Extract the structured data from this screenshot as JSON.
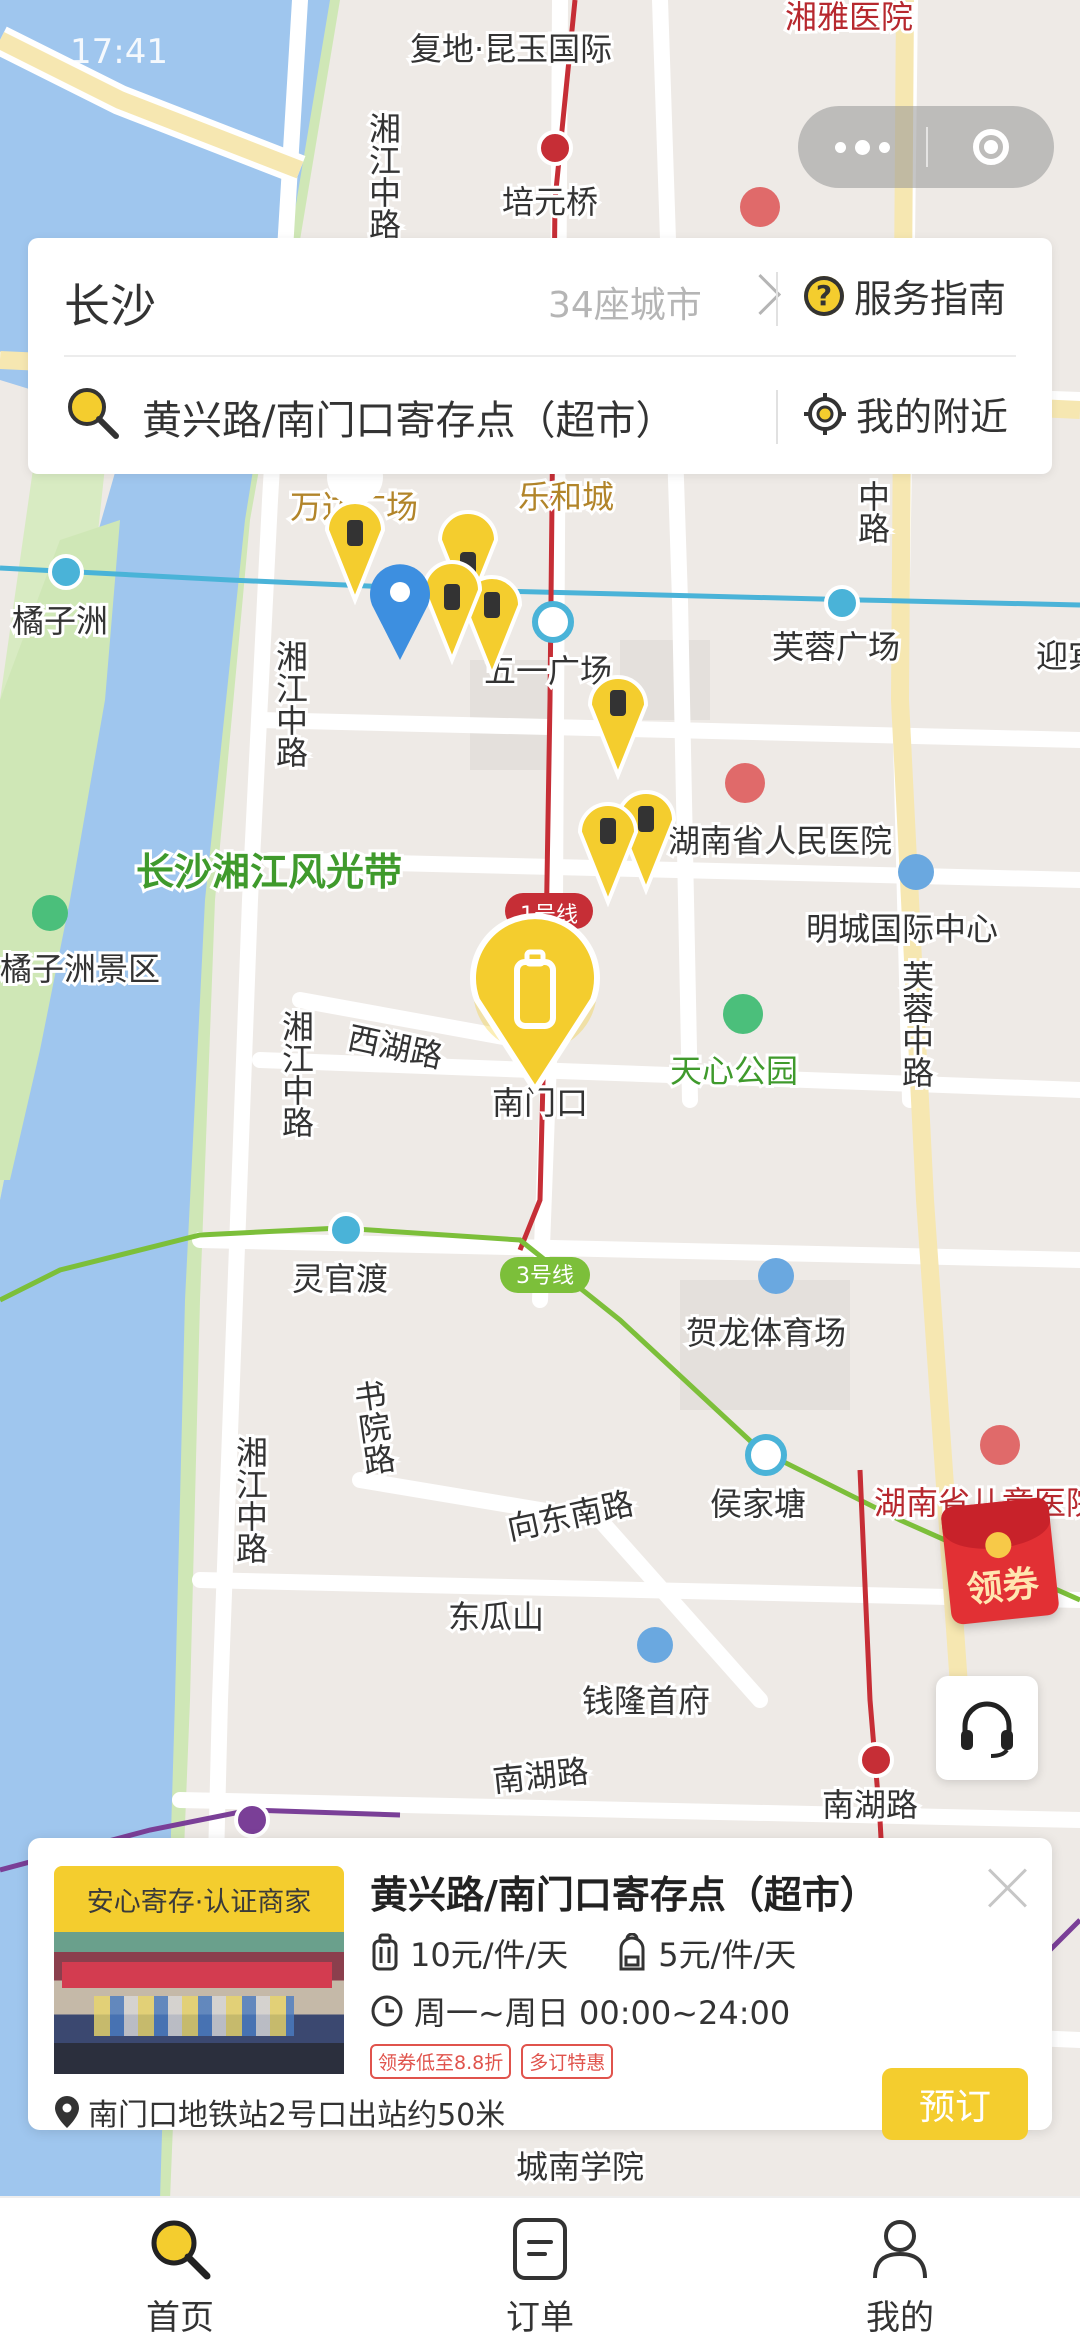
{
  "status_bar": {
    "time": "17:41"
  },
  "search_card": {
    "city": "长沙",
    "city_count": "34座城市",
    "service_guide": "服务指南",
    "search_text": "黄兴路/南门口寄存点（超市）",
    "nearby": "我的附近"
  },
  "map": {
    "labels": {
      "fudi": "复地·昆玉国际",
      "xiangya": "湘雅医院",
      "peiyuanqiao": "培元桥",
      "xiangjiang_zhonglu_1": "湘江中路",
      "xiangjiang_zhonglu_2": "湘江中路",
      "xiangjiang_zhonglu_3": "湘江中路",
      "xiangjiang_zhonglu_4": "湘江中路",
      "wanda": "万达广场",
      "lehecheng": "乐和城",
      "juzizhou": "橘子洲",
      "wuyi": "五一广场",
      "furong_square": "芙蓉广场",
      "yingbin": "迎宾",
      "zhonglu": "中路",
      "hospital": "湖南省人民医院",
      "scenic_belt": "长沙湘江风光带",
      "juzizhou_scenic": "橘子洲景区",
      "mingcheng": "明城国际中心",
      "furong_zhonglu": "芙蓉中路",
      "line1": "1号线",
      "xihu": "西湖路",
      "nanmenkou": "南门口",
      "tianxin": "天心公园",
      "lingguandu": "灵官渡",
      "line3": "3号线",
      "helong": "贺龙体育场",
      "shuyuan": "书院路",
      "houjiatang": "侯家塘",
      "children_hospital": "湖南省儿童医院",
      "xiangdongnan": "向东南路",
      "dongguashan": "东瓜山",
      "qianlong": "钱隆首府",
      "nanhu": "南湖路",
      "nanhu_station": "南湖路",
      "chengnan": "城南学院"
    }
  },
  "coupon_button": {
    "label": "领券"
  },
  "store_card": {
    "badge": "安心寄存·认证商家",
    "title": "黄兴路/南门口寄存点（超市）",
    "price_luggage": "10元/件/天",
    "price_bag": "5元/件/天",
    "hours": "周一~周日 00:00~24:00",
    "tags": [
      "领券低至8.8折",
      "多订特惠"
    ],
    "location": "南门口地铁站2号口出站约50米",
    "book": "预订"
  },
  "nav": {
    "items": [
      {
        "label": "首页",
        "icon": "magnifier-icon"
      },
      {
        "label": "订单",
        "icon": "order-icon"
      },
      {
        "label": "我的",
        "icon": "profile-icon"
      }
    ]
  },
  "colors": {
    "accent": "#f4cd2e",
    "river": "#9fc6ee",
    "metro_line1": "#c62e36",
    "metro_line3": "#7cbf3a",
    "metro_line2": "#4ab3d8",
    "metro_line4": "#7a3f97"
  }
}
